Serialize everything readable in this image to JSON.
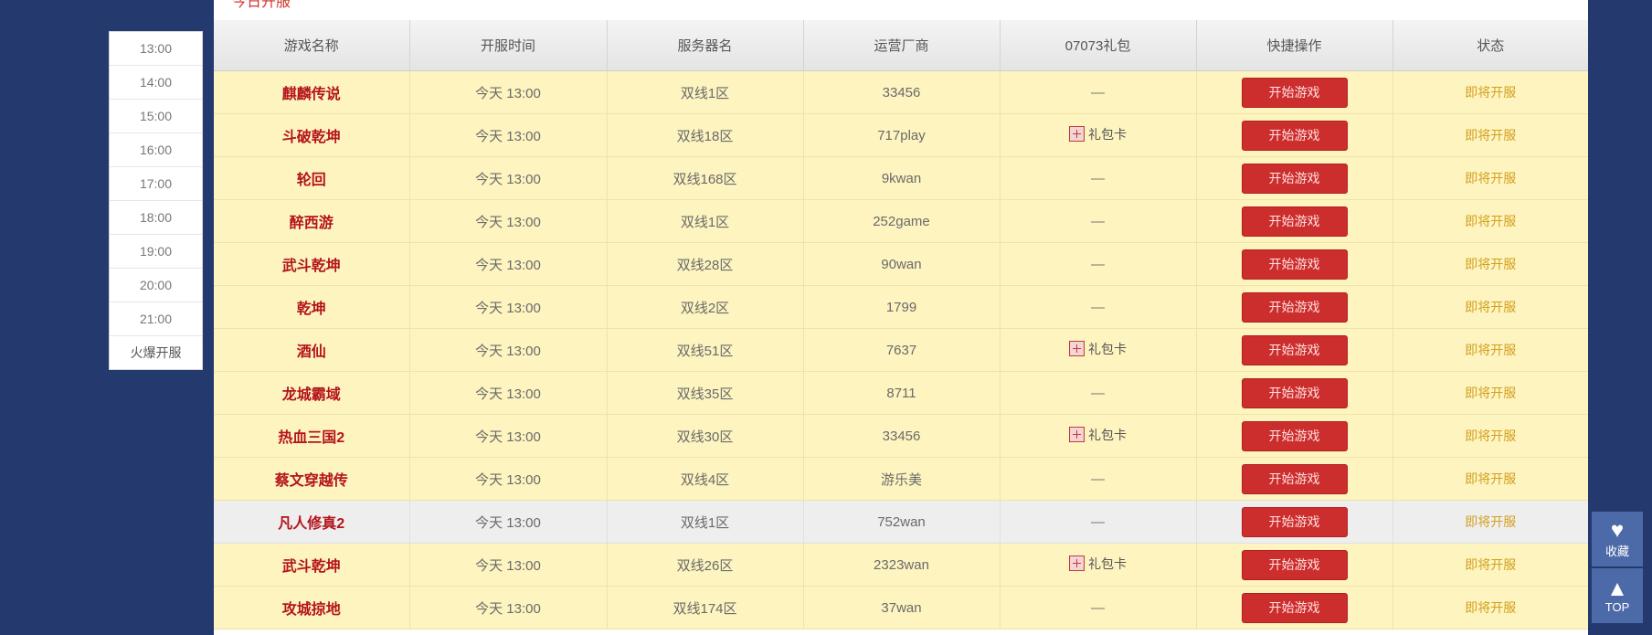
{
  "time_nav": {
    "items": [
      "13:00",
      "14:00",
      "15:00",
      "16:00",
      "17:00",
      "18:00",
      "19:00",
      "20:00",
      "21:00",
      "火爆开服"
    ]
  },
  "section": {
    "title": "今日开服",
    "more": ""
  },
  "table": {
    "headers": [
      "游戏名称",
      "开服时间",
      "服务器名",
      "运营厂商",
      "07073礼包",
      "快捷操作",
      "状态"
    ],
    "button_label": "开始游戏",
    "gift_label": "礼包卡",
    "dash": "—",
    "rows": [
      {
        "name": "麒麟传说",
        "time": "今天 13:00",
        "server": "双线1区",
        "operator": "33456",
        "gift": false,
        "status": "即将开服",
        "style": "yellow"
      },
      {
        "name": "斗破乾坤",
        "time": "今天 13:00",
        "server": "双线18区",
        "operator": "717play",
        "gift": true,
        "status": "即将开服",
        "style": "yellow"
      },
      {
        "name": "轮回",
        "time": "今天 13:00",
        "server": "双线168区",
        "operator": "9kwan",
        "gift": false,
        "status": "即将开服",
        "style": "yellow"
      },
      {
        "name": "醉西游",
        "time": "今天 13:00",
        "server": "双线1区",
        "operator": "252game",
        "gift": false,
        "status": "即将开服",
        "style": "yellow"
      },
      {
        "name": "武斗乾坤",
        "time": "今天 13:00",
        "server": "双线28区",
        "operator": "90wan",
        "gift": false,
        "status": "即将开服",
        "style": "yellow"
      },
      {
        "name": "乾坤",
        "time": "今天 13:00",
        "server": "双线2区",
        "operator": "1799",
        "gift": false,
        "status": "即将开服",
        "style": "yellow"
      },
      {
        "name": "酒仙",
        "time": "今天 13:00",
        "server": "双线51区",
        "operator": "7637",
        "gift": true,
        "status": "即将开服",
        "style": "yellow"
      },
      {
        "name": "龙城霸域",
        "time": "今天 13:00",
        "server": "双线35区",
        "operator": "8711",
        "gift": false,
        "status": "即将开服",
        "style": "yellow"
      },
      {
        "name": "热血三国2",
        "time": "今天 13:00",
        "server": "双线30区",
        "operator": "33456",
        "gift": true,
        "status": "即将开服",
        "style": "yellow"
      },
      {
        "name": "蔡文穿越传",
        "time": "今天 13:00",
        "server": "双线4区",
        "operator": "游乐美",
        "gift": false,
        "status": "即将开服",
        "style": "yellow"
      },
      {
        "name": "凡人修真2",
        "time": "今天 13:00",
        "server": "双线1区",
        "operator": "752wan",
        "gift": false,
        "status": "即将开服",
        "style": "gray"
      },
      {
        "name": "武斗乾坤",
        "time": "今天 13:00",
        "server": "双线26区",
        "operator": "2323wan",
        "gift": true,
        "status": "即将开服",
        "style": "yellow"
      },
      {
        "name": "攻城掠地",
        "time": "今天 13:00",
        "server": "双线174区",
        "operator": "37wan",
        "gift": false,
        "status": "即将开服",
        "style": "yellow"
      }
    ]
  },
  "float_tools": {
    "favorite_label": "收藏",
    "top_label": "TOP"
  }
}
